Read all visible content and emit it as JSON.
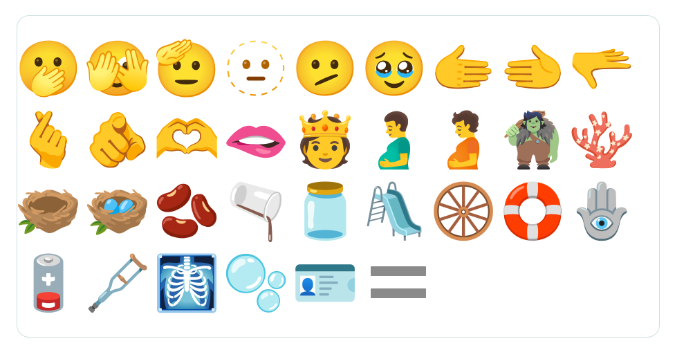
{
  "emojis": [
    {
      "char": "🫢",
      "name": "face-with-open-eyes-and-hand-over-mouth"
    },
    {
      "char": "🫣",
      "name": "face-with-peeking-eye"
    },
    {
      "char": "🫡",
      "name": "saluting-face"
    },
    {
      "char": "🫥",
      "name": "dotted-line-face"
    },
    {
      "char": "🫤",
      "name": "face-with-diagonal-mouth"
    },
    {
      "char": "🥹",
      "name": "face-holding-back-tears"
    },
    {
      "char": "🫱",
      "name": "rightwards-hand"
    },
    {
      "char": "🫲",
      "name": "leftwards-hand"
    },
    {
      "char": "🫳",
      "name": "palm-down-hand"
    },
    {
      "char": "🫰",
      "name": "hand-with-index-finger-and-thumb-crossed"
    },
    {
      "char": "🫵",
      "name": "index-pointing-at-the-viewer"
    },
    {
      "char": "🫶",
      "name": "heart-hands"
    },
    {
      "char": "🫦",
      "name": "biting-lip"
    },
    {
      "char": "🫅",
      "name": "person-with-crown"
    },
    {
      "char": "🫃",
      "name": "pregnant-man"
    },
    {
      "char": "🫄",
      "name": "pregnant-person"
    },
    {
      "char": "🧌",
      "name": "troll"
    },
    {
      "char": "🪸",
      "name": "coral"
    },
    {
      "char": "🪹",
      "name": "empty-nest"
    },
    {
      "char": "🪺",
      "name": "nest-with-eggs"
    },
    {
      "char": "🫘",
      "name": "beans"
    },
    {
      "char": "🫗",
      "name": "pouring-liquid"
    },
    {
      "char": "🫙",
      "name": "jar"
    },
    {
      "char": "🛝",
      "name": "playground-slide"
    },
    {
      "char": "🛞",
      "name": "wheel"
    },
    {
      "char": "🛟",
      "name": "ring-buoy"
    },
    {
      "char": "🪬",
      "name": "hamsa"
    },
    {
      "char": "🪫",
      "name": "low-battery"
    },
    {
      "char": "🩼",
      "name": "crutch"
    },
    {
      "char": "🩻",
      "name": "x-ray"
    },
    {
      "char": "🫧",
      "name": "bubbles"
    },
    {
      "char": "🪪",
      "name": "identification-card"
    },
    {
      "char": "🟰",
      "name": "heavy-equals-sign"
    }
  ]
}
